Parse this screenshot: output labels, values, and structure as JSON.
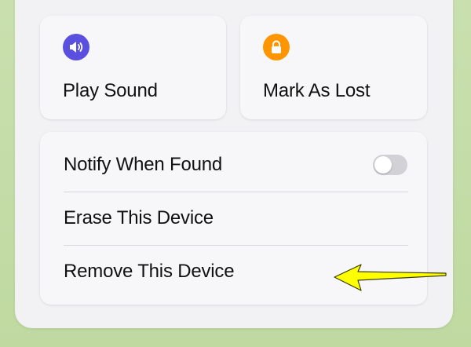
{
  "actions": {
    "play_sound": {
      "label": "Play Sound",
      "icon": "speaker-icon",
      "color": "#5b4fe0"
    },
    "mark_as_lost": {
      "label": "Mark As Lost",
      "icon": "lock-icon",
      "color": "#ff9500"
    }
  },
  "settings": [
    {
      "label": "Notify When Found",
      "toggle": false
    },
    {
      "label": "Erase This Device"
    },
    {
      "label": "Remove This Device"
    }
  ],
  "annotation": {
    "arrow_color": "#ffff00"
  }
}
